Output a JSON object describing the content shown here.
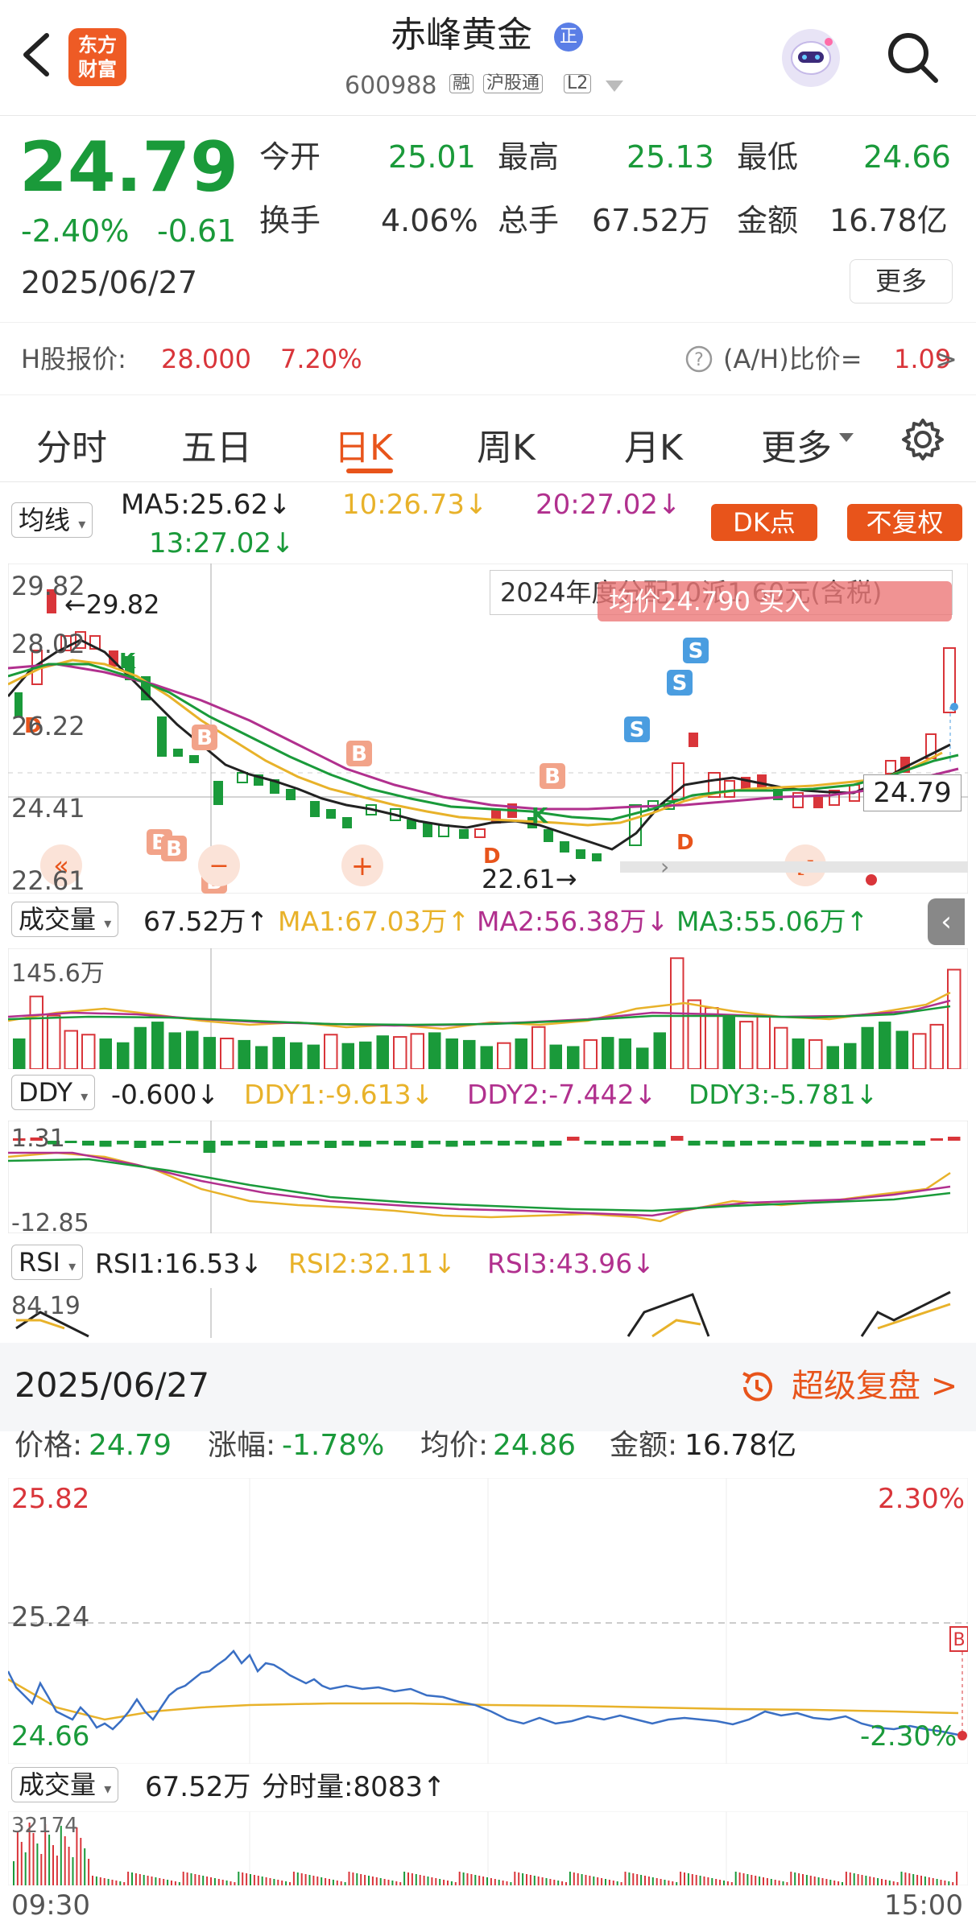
{
  "header": {
    "title": "赤峰黄金",
    "badge": "正",
    "code": "600988",
    "tags": [
      "融",
      "沪股通",
      "L2"
    ]
  },
  "quote": {
    "price": "24.79",
    "change_pct": "-2.40%",
    "change": "-0.61",
    "date": "2025/06/27",
    "open_label": "今开",
    "open": "25.01",
    "high_label": "最高",
    "high": "25.13",
    "low_label": "最低",
    "low": "24.66",
    "turnover_label": "换手",
    "turnover": "4.06%",
    "volume_label": "总手",
    "volume": "67.52万",
    "amount_label": "金额",
    "amount": "16.78亿",
    "more": "更多"
  },
  "hshare": {
    "label": "H股报价:",
    "price": "28.000",
    "pct": "7.20%",
    "ah_label": "(A/H)比价=",
    "ah_value": "1.09",
    "arrow": ">"
  },
  "tabs": [
    {
      "label": "分时"
    },
    {
      "label": "五日"
    },
    {
      "label": "日K"
    },
    {
      "label": "周K"
    },
    {
      "label": "月K"
    },
    {
      "label": "更多"
    }
  ],
  "kline": {
    "ma_select": "均线",
    "ma5": "MA5:25.62↓",
    "ma10": "10:26.73↓",
    "ma20": "20:27.02↓",
    "ma13": "13:27.02↓",
    "dk_button": "DK点",
    "fq_button": "不复权",
    "y_labels": [
      "29.82",
      "28.02",
      "26.22",
      "24.41",
      "22.61"
    ],
    "high_marker": "←29.82",
    "low_marker": "22.61→",
    "notice": "2024年度分配10派1.60元(含税)",
    "avg_banner": "均价24.790  买入",
    "last_price": "24.79"
  },
  "volume": {
    "select": "成交量",
    "value": "67.52万↑",
    "ma1": "MA1:67.03万↑",
    "ma2": "MA2:56.38万↓",
    "ma3": "MA3:55.06万↑",
    "max": "145.6万"
  },
  "ddy": {
    "select": "DDY",
    "value": "-0.600↓",
    "ddy1": "DDY1:-9.613↓",
    "ddy2": "DDY2:-7.442↓",
    "ddy3": "DDY3:-5.781↓",
    "top": "1.31",
    "bottom": "-12.85"
  },
  "rsi": {
    "select": "RSI",
    "rsi1": "RSI1:16.53↓",
    "rsi2": "RSI2:32.11↓",
    "rsi3": "RSI3:43.96↓",
    "top": "84.19"
  },
  "intraday": {
    "date": "2025/06/27",
    "replay": "超级复盘 >",
    "price_label": "价格:",
    "price": "24.79",
    "chg_label": "涨幅:",
    "chg": "-1.78%",
    "avg_label": "均价:",
    "avg": "24.86",
    "amount_label": "金额:",
    "amount": "16.78亿",
    "y_top": "25.82",
    "y_mid": "25.24",
    "y_bottom": "24.66",
    "pct_top": "2.30%",
    "pct_bottom": "-2.30%",
    "vol_select": "成交量",
    "vol_value": "67.52万",
    "minute_vol": "分时量:8083↑",
    "vol_max": "32174",
    "time_start": "09:30",
    "time_end": "15:00"
  },
  "colors": {
    "up": "#d9353a",
    "down": "#1a9a3a",
    "accent": "#e8541b",
    "ma5": "#222222",
    "ma10": "#e8b22a",
    "ma20": "#b1308e",
    "ma13": "#1a9a3a"
  }
}
